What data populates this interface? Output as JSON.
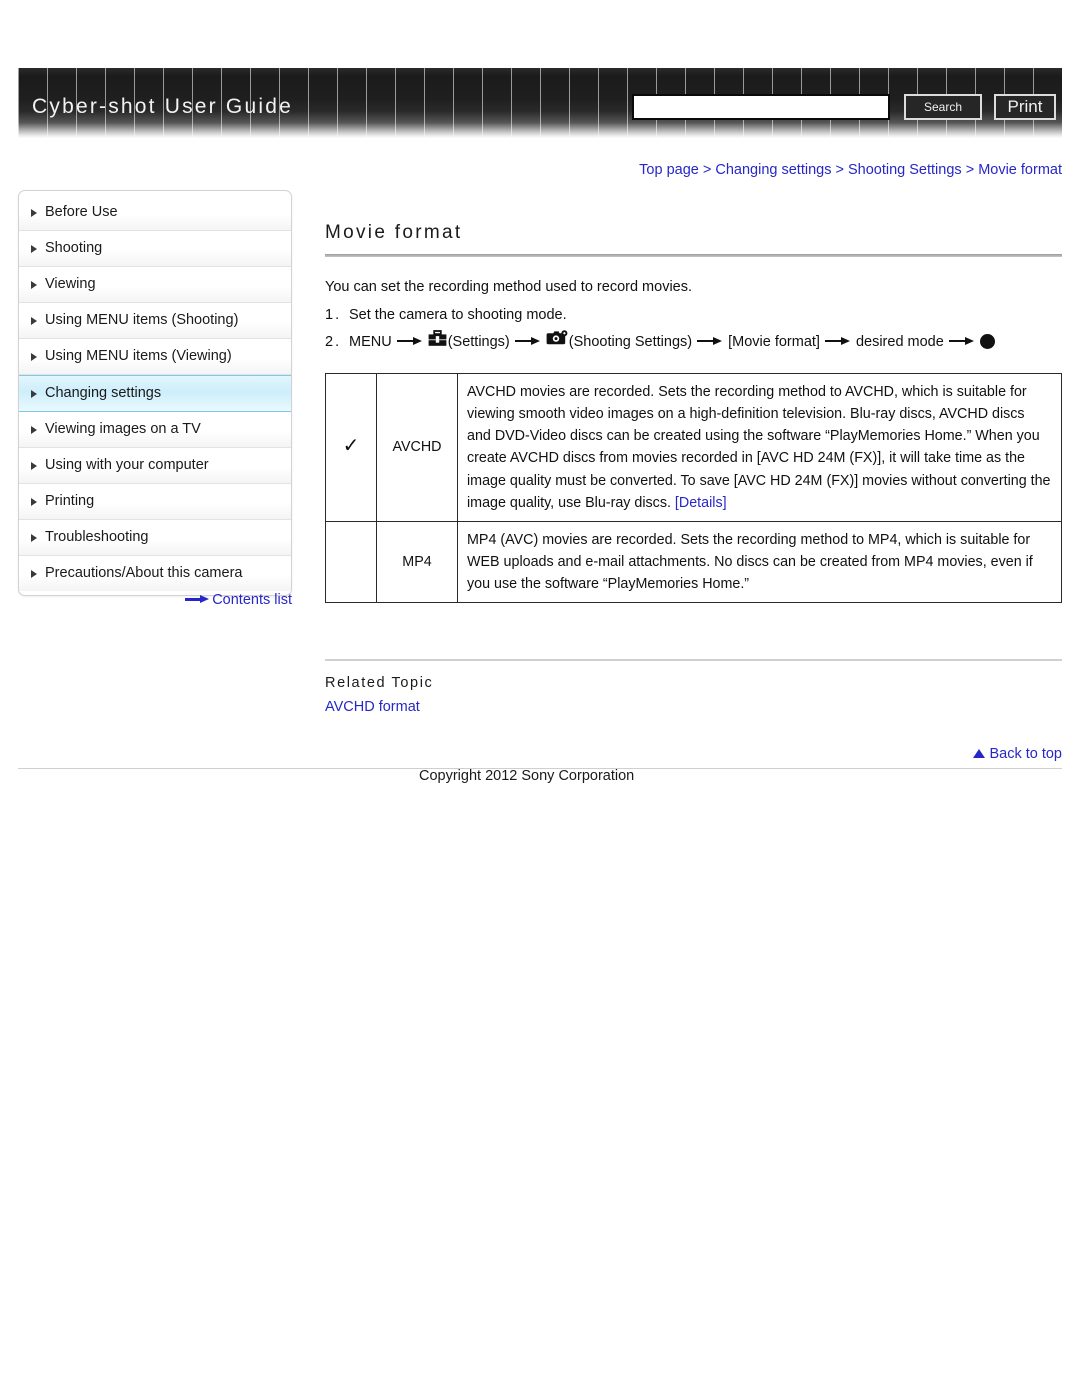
{
  "header": {
    "title": "Cyber-shot User Guide",
    "search_value": "",
    "search_placeholder": "",
    "search_button": "Search",
    "print_button": "Print"
  },
  "breadcrumb": {
    "items": [
      "Top page",
      "Changing settings",
      "Shooting Settings",
      "Movie format"
    ],
    "separator": ">"
  },
  "sidebar": {
    "items": [
      {
        "label": "Before Use",
        "active": false
      },
      {
        "label": "Shooting",
        "active": false
      },
      {
        "label": "Viewing",
        "active": false
      },
      {
        "label": "Using MENU items (Shooting)",
        "active": false
      },
      {
        "label": "Using MENU items (Viewing)",
        "active": false
      },
      {
        "label": "Changing settings",
        "active": true
      },
      {
        "label": "Viewing images on a TV",
        "active": false
      },
      {
        "label": "Using with your computer",
        "active": false
      },
      {
        "label": "Printing",
        "active": false
      },
      {
        "label": "Troubleshooting",
        "active": false
      },
      {
        "label": "Precautions/About this camera",
        "active": false
      }
    ],
    "contents_list": "Contents list"
  },
  "main": {
    "title": "Movie format",
    "intro": "You can set the recording method used to record movies.",
    "steps": [
      {
        "num": "1.",
        "text": "Set the camera to shooting mode."
      },
      {
        "num": "2.",
        "menu": "MENU",
        "settings_label": "(Settings)",
        "shooting_settings_label": "(Shooting Settings)",
        "item": "[Movie format]",
        "desired": "desired mode"
      }
    ],
    "table": {
      "rows": [
        {
          "checked": true,
          "check_glyph": "✓",
          "name": "AVCHD",
          "description": "AVCHD movies are recorded. Sets the recording method to AVCHD, which is suitable for viewing smooth video images on a high-definition television. Blu-ray discs, AVCHD discs and DVD-Video discs can be created using the software “PlayMemories Home.” When you create AVCHD discs from movies recorded in [AVC HD 24M (FX)], it will take time as the image quality must be converted. To save [AVC HD 24M (FX)] movies without converting the image quality, use Blu-ray discs. ",
          "link": "[Details]"
        },
        {
          "checked": false,
          "check_glyph": "",
          "name": "MP4",
          "description": "MP4 (AVC) movies are recorded. Sets the recording method to MP4, which is suitable for WEB uploads and e-mail attachments. No discs can be created from MP4 movies, even if you use the software “PlayMemories Home.”",
          "link": ""
        }
      ]
    },
    "related": {
      "heading": "Related Topic",
      "link": "AVCHD format"
    }
  },
  "footer": {
    "back_to_top": "Back to top",
    "copyright": "Copyright 2012 Sony Corporation"
  },
  "colors": {
    "link": "#2727c8",
    "header_bg": "#1b1b1b",
    "sidebar_active": "#cdeefb"
  }
}
